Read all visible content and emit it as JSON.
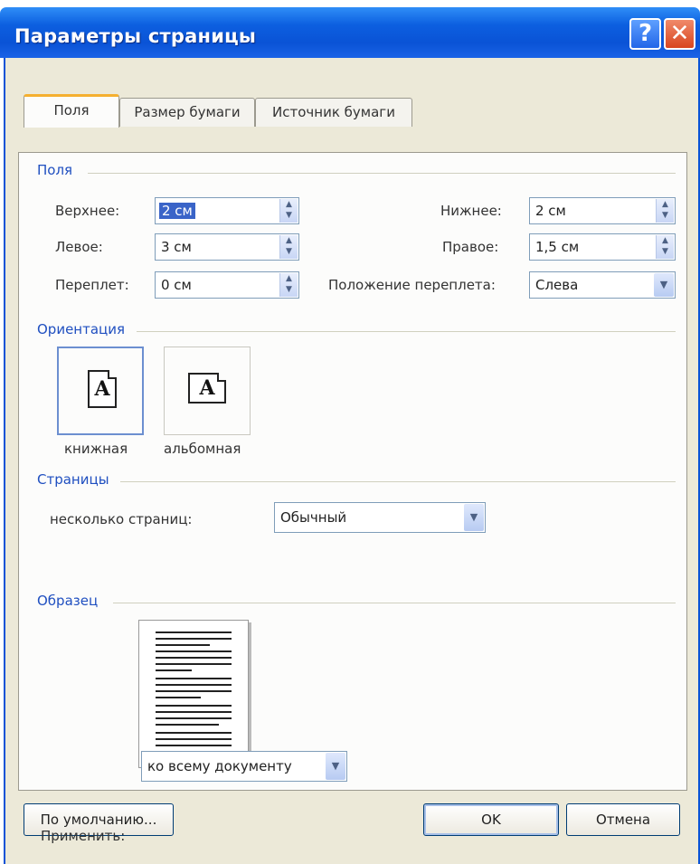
{
  "window": {
    "title": "Параметры страницы",
    "help_glyph": "?",
    "close_glyph": "✕"
  },
  "tabs": [
    {
      "label": "Поля",
      "active": true
    },
    {
      "label": "Размер бумаги",
      "active": false
    },
    {
      "label": "Источник бумаги",
      "active": false
    }
  ],
  "margins": {
    "group_label": "Поля",
    "top_label": "Верхнее:",
    "top_value": "2 см",
    "bottom_label": "Нижнее:",
    "bottom_value": "2 см",
    "left_label": "Левое:",
    "left_value": "3 см",
    "right_label": "Правое:",
    "right_value": "1,5 см",
    "gutter_label": "Переплет:",
    "gutter_value": "0 см",
    "gutter_pos_label": "Положение переплета:",
    "gutter_pos_value": "Слева"
  },
  "orientation": {
    "group_label": "Ориентация",
    "portrait_label": "книжная",
    "landscape_label": "альбомная",
    "icon_letter": "A",
    "selected": "portrait"
  },
  "pages": {
    "group_label": "Страницы",
    "multiple_label": "несколько страниц:",
    "multiple_value": "Обычный"
  },
  "preview": {
    "group_label": "Образец"
  },
  "apply": {
    "label": "Применить:",
    "value": "ко всему документу"
  },
  "buttons": {
    "default_label": "По умолчанию...",
    "ok_label": "OK",
    "cancel_label": "Отмена"
  },
  "colors": {
    "titlebar": "#0a53d6",
    "face": "#ece9d8",
    "group_text": "#1f4fc0",
    "tab_highlight": "#f5b030"
  }
}
